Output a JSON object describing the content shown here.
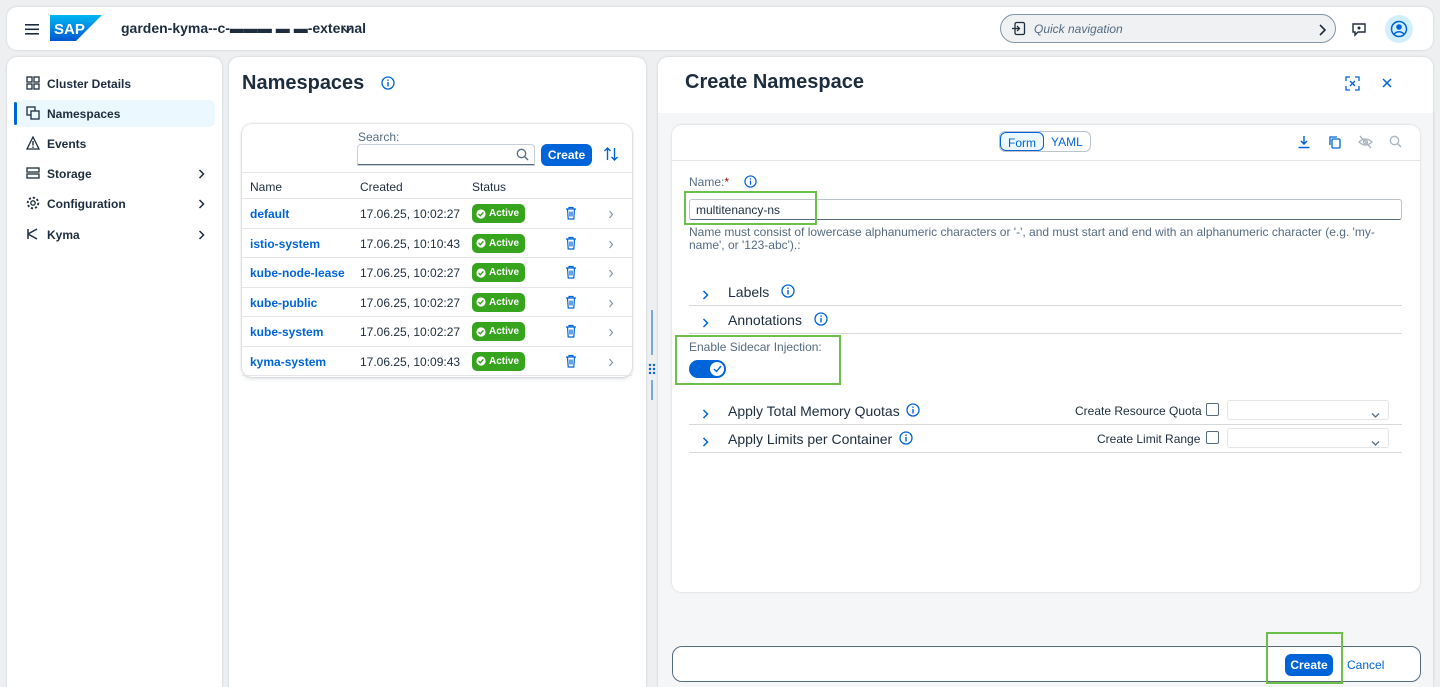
{
  "shell": {
    "cluster_name": "garden-kyma--c-▬▬▬ ▬ ▬-external",
    "quick_nav_placeholder": "Quick navigation",
    "logo_text": "SAP"
  },
  "sidebar": {
    "items": [
      {
        "label": "Cluster Details",
        "icon": "cluster-icon",
        "has_arrow": false
      },
      {
        "label": "Namespaces",
        "icon": "namespaces-icon",
        "has_arrow": false,
        "selected": true
      },
      {
        "label": "Events",
        "icon": "warning-icon",
        "has_arrow": false
      },
      {
        "label": "Storage",
        "icon": "storage-icon",
        "has_arrow": true
      },
      {
        "label": "Configuration",
        "icon": "gear-icon",
        "has_arrow": true
      },
      {
        "label": "Kyma",
        "icon": "kyma-icon",
        "has_arrow": true
      }
    ]
  },
  "namespaces": {
    "title": "Namespaces",
    "search_label": "Search:",
    "create_label": "Create",
    "columns": [
      "Name",
      "Created",
      "Status"
    ],
    "rows": [
      {
        "name": "default",
        "created": "17.06.25, 10:02:27",
        "status": "Active"
      },
      {
        "name": "istio-system",
        "created": "17.06.25, 10:10:43",
        "status": "Active"
      },
      {
        "name": "kube-node-lease",
        "created": "17.06.25, 10:02:27",
        "status": "Active"
      },
      {
        "name": "kube-public",
        "created": "17.06.25, 10:02:27",
        "status": "Active"
      },
      {
        "name": "kube-system",
        "created": "17.06.25, 10:02:27",
        "status": "Active"
      },
      {
        "name": "kyma-system",
        "created": "17.06.25, 10:09:43",
        "status": "Active"
      }
    ]
  },
  "create": {
    "title": "Create Namespace",
    "tabs": [
      "Form",
      "YAML"
    ],
    "active_tab": "Form",
    "name_label": "Name:",
    "required_mark": "*",
    "name_value": "multitenancy-ns",
    "name_hint": "Name must consist of lowercase alphanumeric characters or '-', and must start and end with an alphanumeric character (e.g. 'my-name', or '123-abc').:",
    "labels_label": "Labels",
    "annotations_label": "Annotations",
    "sidecar_label": "Enable Sidecar Injection:",
    "sidecar_enabled": true,
    "memory_quotas_label": "Apply Total Memory Quotas",
    "resource_quota_label": "Create Resource Quota",
    "limits_label": "Apply Limits per Container",
    "limit_range_label": "Create Limit Range",
    "footer_create": "Create",
    "footer_cancel": "Cancel"
  },
  "colors": {
    "accent": "#0064d9",
    "status_active": "#36a41d",
    "highlight": "#6cc04a"
  }
}
